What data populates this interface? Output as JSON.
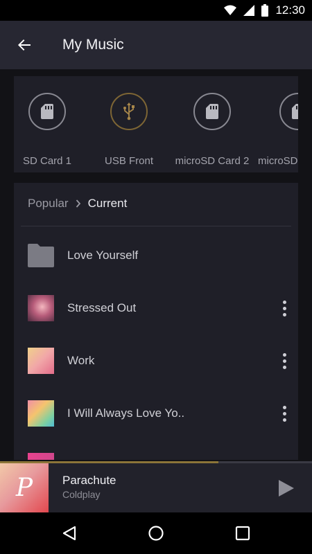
{
  "status_bar": {
    "time": "12:30"
  },
  "app_bar": {
    "title": "My Music"
  },
  "sources": [
    {
      "label": "SD Card 1",
      "icon": "sd-card-icon"
    },
    {
      "label": "USB Front",
      "icon": "usb-icon"
    },
    {
      "label": "microSD Card 2",
      "icon": "sd-card-icon"
    },
    {
      "label": "microSD",
      "icon": "sd-card-icon"
    }
  ],
  "breadcrumb": {
    "parent": "Popular",
    "current": "Current"
  },
  "items": [
    {
      "title": "Love Yourself",
      "type": "folder"
    },
    {
      "title": "Stressed Out",
      "type": "track"
    },
    {
      "title": "Work",
      "type": "track"
    },
    {
      "title": "I Will Always Love Yo..",
      "type": "track"
    }
  ],
  "now_playing": {
    "title": "Parachute",
    "artist": "Coldplay",
    "art_letter": "P",
    "progress": 0.7
  },
  "colors": {
    "accent_gold": "#8c7538",
    "card_bg": "#1f1f28",
    "app_bar_bg": "#272732"
  }
}
